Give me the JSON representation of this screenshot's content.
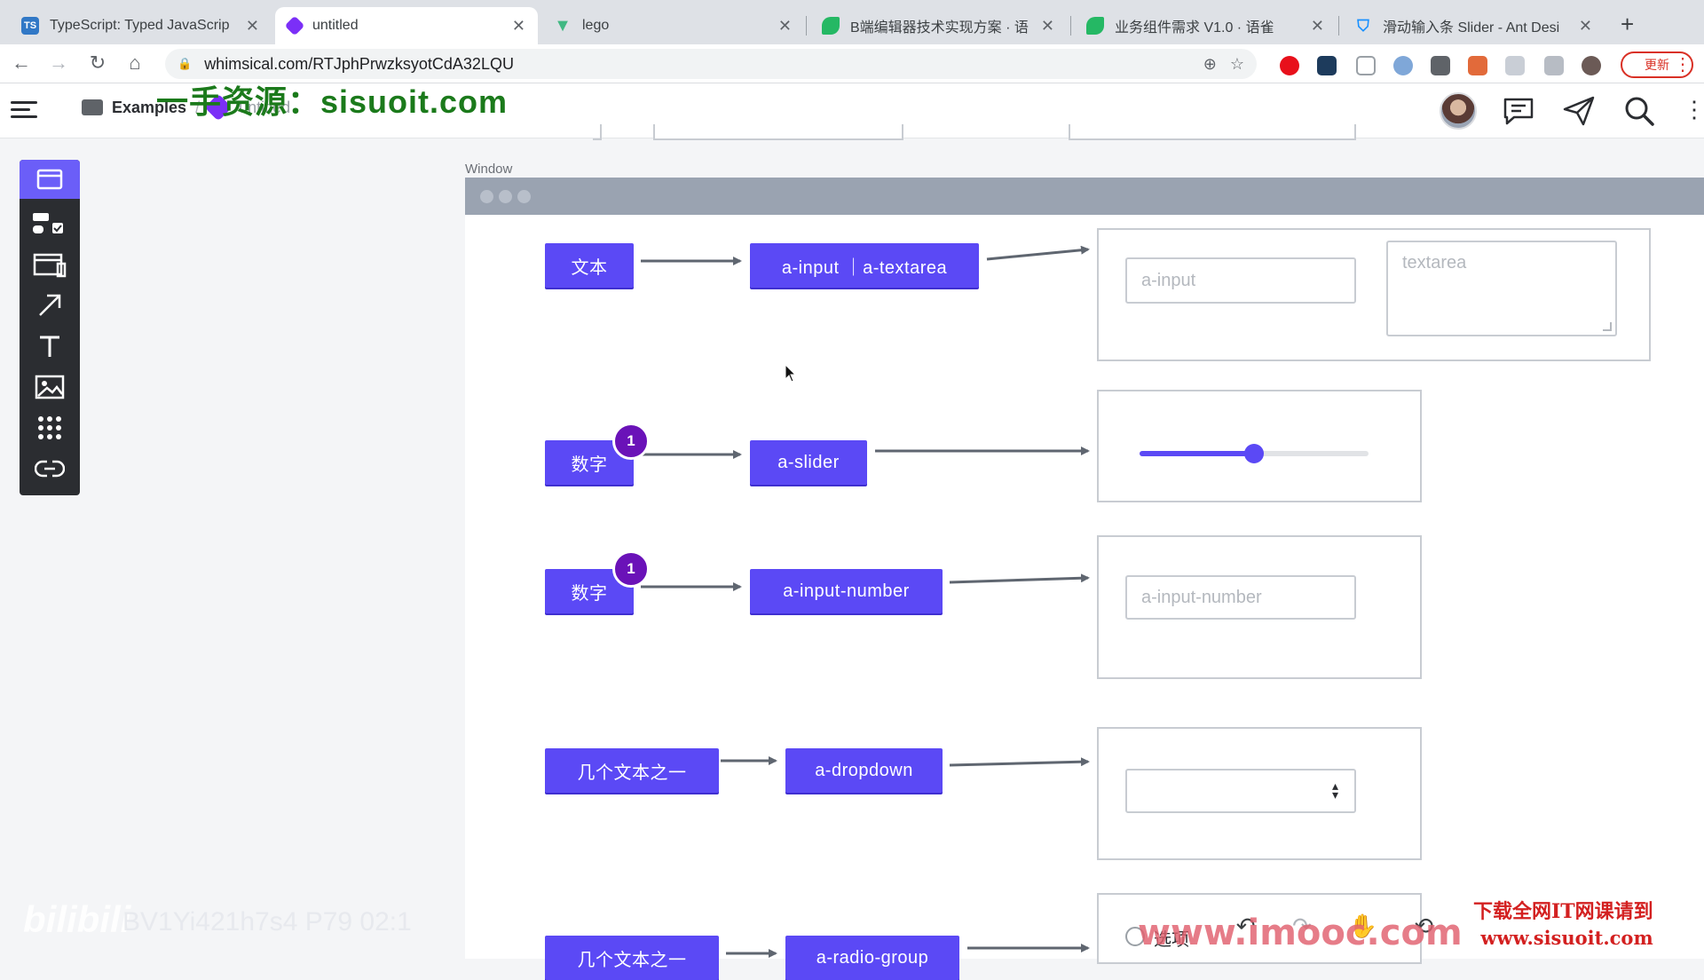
{
  "browser": {
    "tabs": [
      {
        "title": "TypeScript: Typed JavaScrip",
        "favicon": "TS",
        "favicon_color": "#3178c6"
      },
      {
        "title": "untitled",
        "favicon": "F",
        "favicon_color": "#7b2ff7"
      },
      {
        "title": "lego",
        "favicon": "V",
        "favicon_color": "#41b883"
      },
      {
        "title": "B端编辑器技术实现方案 · 语",
        "favicon": "Y",
        "favicon_color": "#25b864"
      },
      {
        "title": "业务组件需求 V1.0 · 语雀",
        "favicon": "Y",
        "favicon_color": "#25b864"
      },
      {
        "title": "滑动输入条 Slider - Ant Desi",
        "favicon": "U",
        "favicon_color": "#1890ff"
      }
    ],
    "url": "whimsical.com/RTJphPrwzksyotCdA32LQU",
    "update_label": "更新"
  },
  "app": {
    "breadcrumb_folder": "Examples",
    "breadcrumb_doc": "untitled",
    "frame_label": "Window"
  },
  "diagram": {
    "rows": [
      {
        "type_label": "文本",
        "component_label": "a-input ｜a-textarea",
        "preview_input_placeholder": "a-input",
        "preview_textarea_placeholder": "textarea"
      },
      {
        "type_label": "数字",
        "badge": "1",
        "component_label": "a-slider",
        "slider_value": 0.5
      },
      {
        "type_label": "数字",
        "badge": "1",
        "component_label": "a-input-number",
        "preview_input_placeholder": "a-input-number"
      },
      {
        "type_label": "几个文本之一",
        "component_label": "a-dropdown"
      },
      {
        "type_label": "几个文本之一",
        "component_label": "a-radio-group",
        "preview_radio_label": "选项"
      }
    ]
  },
  "overlays": {
    "watermark_top": "一手资源：sisuoit.com",
    "watermark_imooc": "www.imooc.com",
    "watermark_sisuo_line1": "下载全网IT网课请到",
    "watermark_sisuo_line2": "www.sisuoit.com",
    "watermark_bili": "bilibili",
    "watermark_bv": "BV1Yi421h7s4 P79 02:1"
  },
  "colors": {
    "node": "#5b49f5",
    "badge": "#6a12b8",
    "slider": "#5b49f5",
    "toolbar": "#2b2d31"
  }
}
